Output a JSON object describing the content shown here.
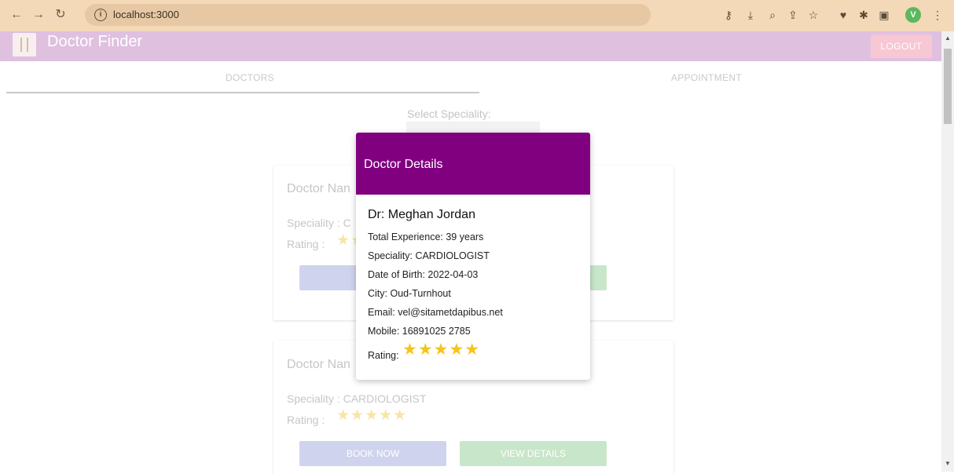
{
  "browser": {
    "url": "localhost:3000",
    "profile_initial": "V"
  },
  "app": {
    "title": "Doctor Finder",
    "logout_label": "LOGOUT"
  },
  "tabs": [
    {
      "label": "DOCTORS",
      "active": true
    },
    {
      "label": "APPOINTMENT",
      "active": false
    }
  ],
  "filter": {
    "label": "Select Speciality:"
  },
  "cards": [
    {
      "name_label": "Doctor Nan",
      "speciality_label": "Speciality : C",
      "rating_label": "Rating :",
      "stars": "★★",
      "book_label": "BO",
      "view_label": ""
    },
    {
      "name_label": "Doctor Nan",
      "speciality_label": "Speciality : CARDIOLOGIST",
      "rating_label": "Rating :",
      "stars": "★★★★★",
      "book_label": "BOOK NOW",
      "view_label": "VIEW DETAILS"
    }
  ],
  "modal": {
    "title": "Doctor Details",
    "name": "Dr: Meghan Jordan",
    "experience": "Total Experience: 39 years",
    "speciality": "Speciality: CARDIOLOGIST",
    "dob": "Date of Birth: 2022-04-03",
    "city": "City: Oud-Turnhout",
    "email": "Email: vel@sitametdapibus.net",
    "mobile": "Mobile: 16891025 2785",
    "rating_label": "Rating:",
    "rating_value": 5,
    "stars": "★★★★★"
  },
  "colors": {
    "modal_header": "#800080",
    "star": "#f5c518",
    "app_header": "#dfc0df"
  }
}
